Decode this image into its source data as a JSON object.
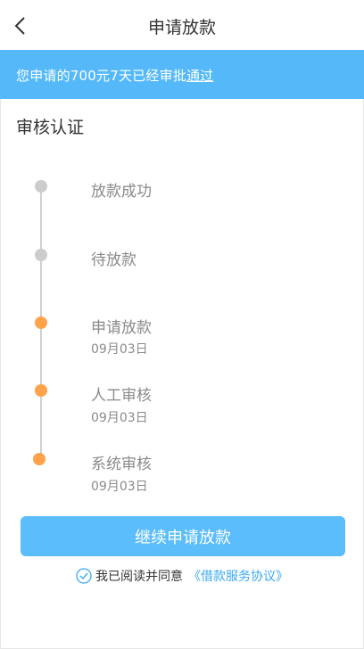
{
  "header": {
    "title": "申请放款"
  },
  "banner": {
    "prefix": "您申请的700元7天已经审批",
    "underlined": "通过"
  },
  "section": {
    "title": "审核认证"
  },
  "timeline": {
    "steps": [
      {
        "label": "放款成功",
        "date": "",
        "status": "pending"
      },
      {
        "label": "待放款",
        "date": "",
        "status": "pending"
      },
      {
        "label": "申请放款",
        "date": "09月03日",
        "status": "done"
      },
      {
        "label": "人工审核",
        "date": "09月03日",
        "status": "done"
      },
      {
        "label": "系统审核",
        "date": "09月03日",
        "status": "done"
      }
    ]
  },
  "actions": {
    "continue_label": "继续申请放款"
  },
  "agreement": {
    "text": "我已阅读并同意",
    "link": "《借款服务协议》"
  },
  "colors": {
    "accent": "#55b9f9",
    "pending_dot": "#cccccc",
    "done_dot": "#ffa24a",
    "link": "#39a9f1"
  }
}
